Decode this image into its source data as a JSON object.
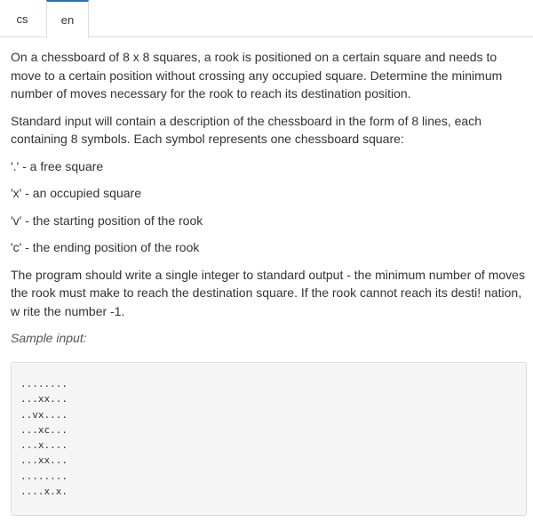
{
  "tabs": [
    {
      "label": "cs",
      "active": false
    },
    {
      "label": "en",
      "active": true
    }
  ],
  "accent_color": "#2f6fb3",
  "problem": {
    "paragraph1": "On a chessboard of 8 x 8 squares, a rook is positioned on a certain square and needs to move to a certain position without crossing any occupied square. Determine the minimum number of moves necessary for the rook to reach its destination position.",
    "paragraph2": "Standard input will contain a description of the chessboard in the form of 8 lines, each containing 8 symbols. Each symbol represents one chessboard square:",
    "legend": [
      "'.' - a free square",
      "'x' - an occupied square",
      "'v' - the starting position of the rook",
      "'c' - the ending position of the rook"
    ],
    "paragraph3": "The program should write a single integer to standard output - the minimum number of moves the rook must make to reach the destination square. If the rook cannot reach its desti! nation, w rite the number -1.",
    "sample_label": "Sample input:",
    "sample_lines": [
      "........",
      "...xx...",
      "..vx....",
      "...xc...",
      "...x....",
      "...xx...",
      "........",
      "....x.x."
    ]
  }
}
